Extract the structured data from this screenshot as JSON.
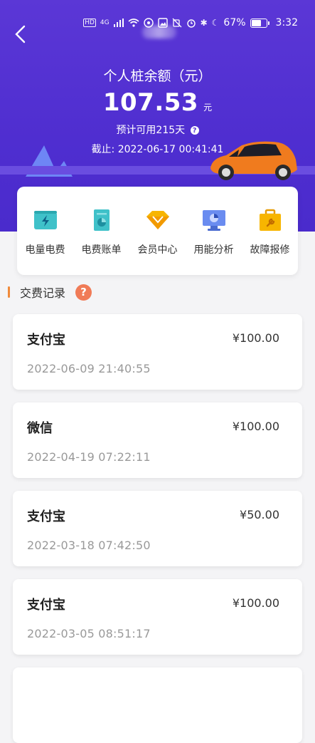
{
  "status_bar": {
    "network_labels": [
      "HD",
      "4G"
    ],
    "battery_percent": "67%",
    "battery_level": 0.67,
    "time": "3:32",
    "icons": [
      "signal-icon",
      "wifi-icon",
      "nfc-icon",
      "photo-icon",
      "mute-icon",
      "alarm-icon",
      "bluetooth-icon",
      "moon-icon",
      "battery-icon"
    ]
  },
  "header": {
    "title": "个人桩余额（元）",
    "balance": "107.53",
    "balance_unit": "元",
    "available_text": "预计可用215天",
    "deadline_text": "截止: 2022-06-17 00:41:41"
  },
  "menu": [
    {
      "label": "电量电费",
      "icon": "lightning-battery-icon",
      "color": "#3fc1c9"
    },
    {
      "label": "电费账单",
      "icon": "bill-icon",
      "color": "#3fc1c9"
    },
    {
      "label": "会员中心",
      "icon": "diamond-icon",
      "color": "#f7b500"
    },
    {
      "label": "用能分析",
      "icon": "monitor-chart-icon",
      "color": "#6a8cf0"
    },
    {
      "label": "故障报修",
      "icon": "toolbox-icon",
      "color": "#f7b500"
    }
  ],
  "records_section": {
    "title": "交费记录",
    "help_symbol": "?"
  },
  "records": [
    {
      "method": "支付宝",
      "amount": "¥100.00",
      "time": "2022-06-09 21:40:55"
    },
    {
      "method": "微信",
      "amount": "¥100.00",
      "time": "2022-04-19 07:22:11"
    },
    {
      "method": "支付宝",
      "amount": "¥50.00",
      "time": "2022-03-18 07:42:50"
    },
    {
      "method": "支付宝",
      "amount": "¥100.00",
      "time": "2022-03-05 08:51:17"
    }
  ],
  "colors": {
    "header_bg": "#5b37d6",
    "accent_orange": "#f08a3a",
    "help_badge": "#f07b57"
  }
}
